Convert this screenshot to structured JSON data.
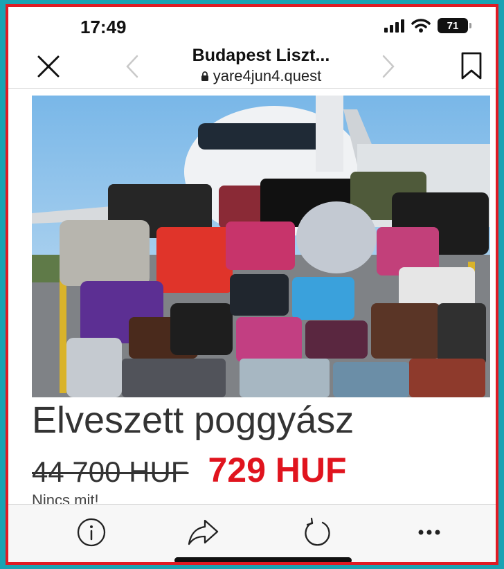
{
  "status_bar": {
    "time": "17:49",
    "battery": "71"
  },
  "browser": {
    "page_title": "Budapest Liszt...",
    "url": "yare4jun4.quest"
  },
  "content": {
    "heading": "Elveszett poggyász",
    "old_price": "44 700 HUF",
    "new_price": "729 HUF",
    "subtext": "Nincs mit!"
  },
  "colors": {
    "background": "#1aa3b3",
    "frame_border": "#e01b24",
    "new_price": "#e0141e"
  },
  "icons": {
    "close": "close-icon",
    "back": "chevron-left-icon",
    "forward": "chevron-right-icon",
    "bookmark": "bookmark-icon",
    "info": "info-icon",
    "share": "share-arrow-icon",
    "reload": "reload-icon",
    "more": "more-icon"
  }
}
